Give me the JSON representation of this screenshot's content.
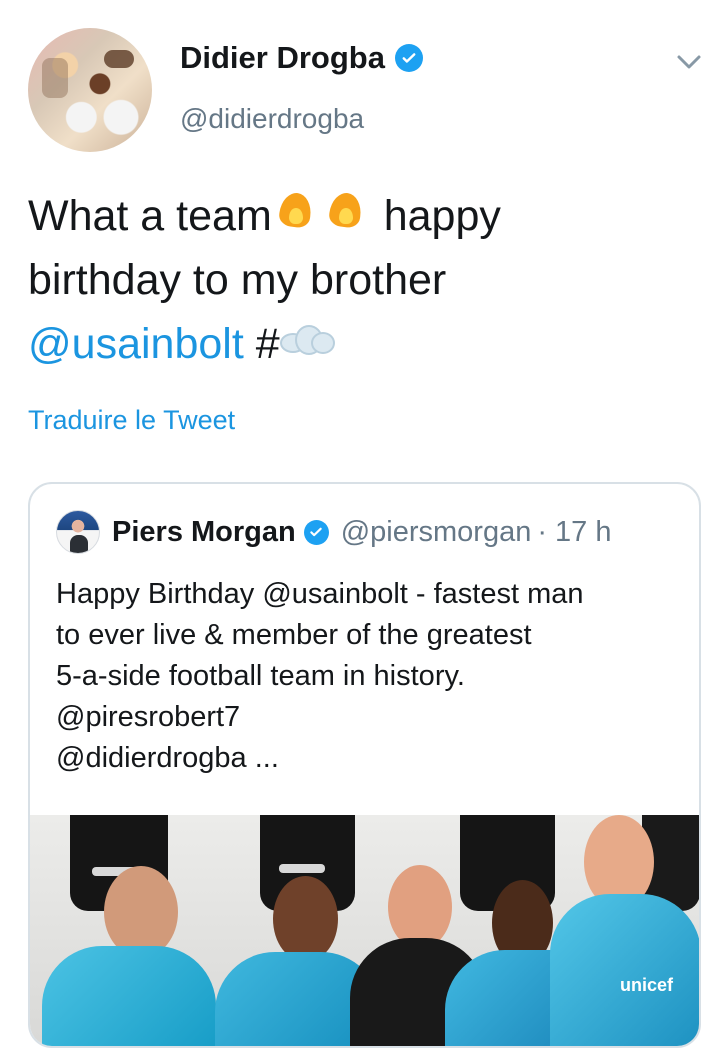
{
  "tweet": {
    "author": {
      "name": "Didier Drogba",
      "handle": "@didierdrogba"
    },
    "text_parts": [
      "What a team",
      "happy",
      "birthday to my brother",
      "@usainbolt",
      "#"
    ],
    "translate_label": "Traduire le Tweet"
  },
  "quoted_tweet": {
    "author": {
      "name": "Piers Morgan",
      "handle": "@piersmorgan",
      "time": "· 17 h"
    },
    "text_lines": [
      "Happy Birthday @usainbolt - fastest man",
      "to ever live & member of the greatest",
      "5-a-side football team in history.",
      "@piresrobert7",
      "@didierdrogba ..."
    ],
    "photo_text": "unicef"
  },
  "icons": {
    "verified": "verified-badge-icon",
    "chevron": "chevron-down-icon",
    "fire": "fire-emoji-icon",
    "dash": "dash-cloud-emoji-icon"
  },
  "colors": {
    "link": "#1b95e0",
    "verified": "#1da1f2",
    "text": "#14171a",
    "secondary_text": "#657786",
    "border": "#d8e0e6"
  }
}
